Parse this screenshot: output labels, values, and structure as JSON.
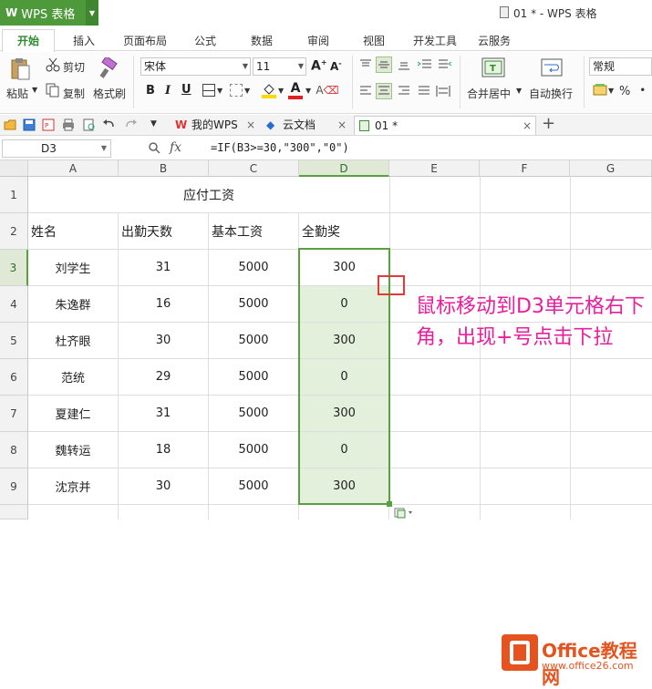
{
  "titlebar": {
    "app_logo": "W",
    "app_name": "WPS 表格",
    "doc_title": "01 * - WPS 表格",
    "accent_color": "#4e9a3b"
  },
  "ribbon_tabs": [
    "开始",
    "插入",
    "页面布局",
    "公式",
    "数据",
    "审阅",
    "视图",
    "开发工具",
    "云服务"
  ],
  "toolbar": {
    "paste": "粘贴",
    "cut": "剪切",
    "copy": "复制",
    "format_painter": "格式刷",
    "font_name": "宋体",
    "font_size": "11",
    "merge_center": "合并居中",
    "wrap_text": "自动换行",
    "number_format": "常规",
    "percent": "%"
  },
  "doc_tabs": [
    {
      "label": "我的WPS",
      "icon": "wps-icon"
    },
    {
      "label": "云文档",
      "icon": "cloud-doc-icon"
    },
    {
      "label": "01 *",
      "icon": "sheet-icon",
      "active": true
    }
  ],
  "formula_bar": {
    "cell_ref": "D3",
    "fx": "fx",
    "formula": "=IF(B3>=30,\"300\",\"0\")"
  },
  "columns": [
    "A",
    "B",
    "C",
    "D",
    "E",
    "F",
    "G"
  ],
  "rows": [
    "1",
    "2",
    "3",
    "4",
    "5",
    "6",
    "7",
    "8",
    "9"
  ],
  "sheet": {
    "title": "应付工资",
    "headers": [
      "姓名",
      "出勤天数",
      "基本工资",
      "全勤奖"
    ],
    "data": [
      [
        "刘学生",
        "31",
        "5000",
        "300"
      ],
      [
        "朱逸群",
        "16",
        "5000",
        "0"
      ],
      [
        "杜齐眼",
        "30",
        "5000",
        "300"
      ],
      [
        "范统",
        "29",
        "5000",
        "0"
      ],
      [
        "夏建仁",
        "31",
        "5000",
        "300"
      ],
      [
        "魏转运",
        "18",
        "5000",
        "0"
      ],
      [
        "沈京并",
        "30",
        "5000",
        "300"
      ]
    ]
  },
  "annotation": "鼠标移动到D3单元格右下角，出现+号点击下拉",
  "watermark": {
    "title": "Office教程网",
    "url": "www.office26.com"
  }
}
